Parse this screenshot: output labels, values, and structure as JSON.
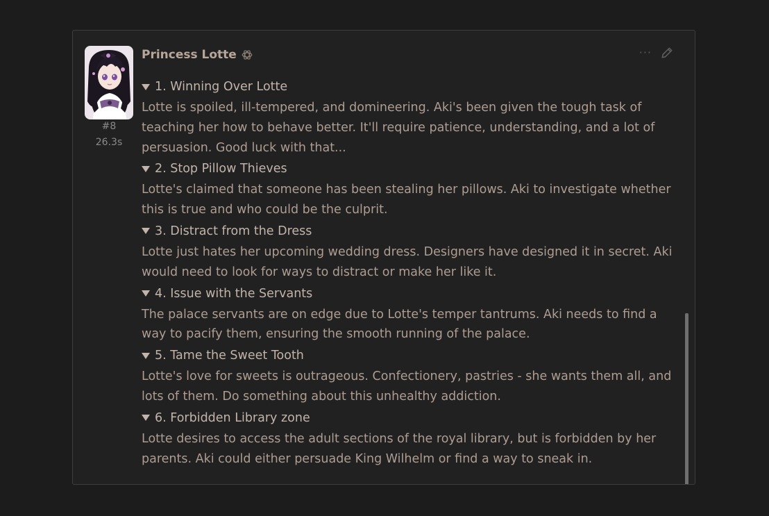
{
  "message": {
    "character_name": "Princess Lotte",
    "message_number": "#8",
    "generation_time": "26.3s",
    "items": [
      {
        "title": "1. Winning Over Lotte",
        "body": "Lotte is spoiled, ill-tempered, and domineering. Aki's been given the tough task of teaching her how to behave better. It'll require patience, understanding, and a lot of persuasion. Good luck with that..."
      },
      {
        "title": "2. Stop Pillow Thieves",
        "body": "Lotte's claimed that someone has been stealing her pillows. Aki to investigate whether this is true and who could be the culprit."
      },
      {
        "title": "3. Distract from the Dress",
        "body": "Lotte just hates her upcoming wedding dress. Designers have designed it in secret. Aki would need to look for ways to distract or make her like it."
      },
      {
        "title": "4. Issue with the Servants",
        "body": "The palace servants are on edge due to Lotte's temper tantrums. Aki needs to find a way to pacify them, ensuring the smooth running of the palace."
      },
      {
        "title": "5. Tame the Sweet Tooth",
        "body": "Lotte's love for sweets is outrageous. Confectionery, pastries - she wants them all, and lots of them. Do something about this unhealthy addiction."
      },
      {
        "title": "6. Forbidden Library zone",
        "body": "Lotte desires to access the adult sections of the royal library, but is forbidden by her parents. Aki could either persuade King Wilhelm or find a way to sneak in."
      }
    ]
  },
  "icons": {
    "model": "openai-logo-icon",
    "more": "more-options-icon",
    "edit": "pencil-edit-icon",
    "expand": "triangle-down-icon"
  },
  "colors": {
    "background": "#1c1c1c",
    "card": "#212121",
    "name": "#b7a79a",
    "text": "#ae9d92"
  }
}
